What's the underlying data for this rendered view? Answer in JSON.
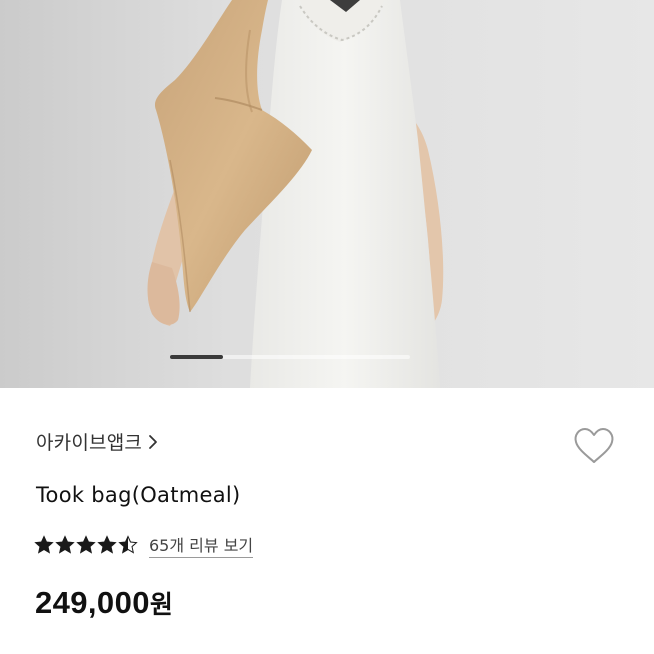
{
  "product": {
    "brand": "아카이브앱크",
    "title": "Took bag(Oatmeal)",
    "rating": 4.5,
    "rating_max": 5,
    "review_link": "65개 리뷰 보기",
    "price": "249,000",
    "price_unit": "원"
  },
  "carousel": {
    "progress": 0.22
  },
  "icons": {
    "brand_chevron": "chevron-right-icon",
    "like": "heart-outline-icon",
    "star": "star-icon"
  },
  "colors": {
    "text_primary": "#111111",
    "text_secondary": "#444444",
    "star": "#1a1a1a",
    "heart_outline": "#9a9a9a"
  }
}
